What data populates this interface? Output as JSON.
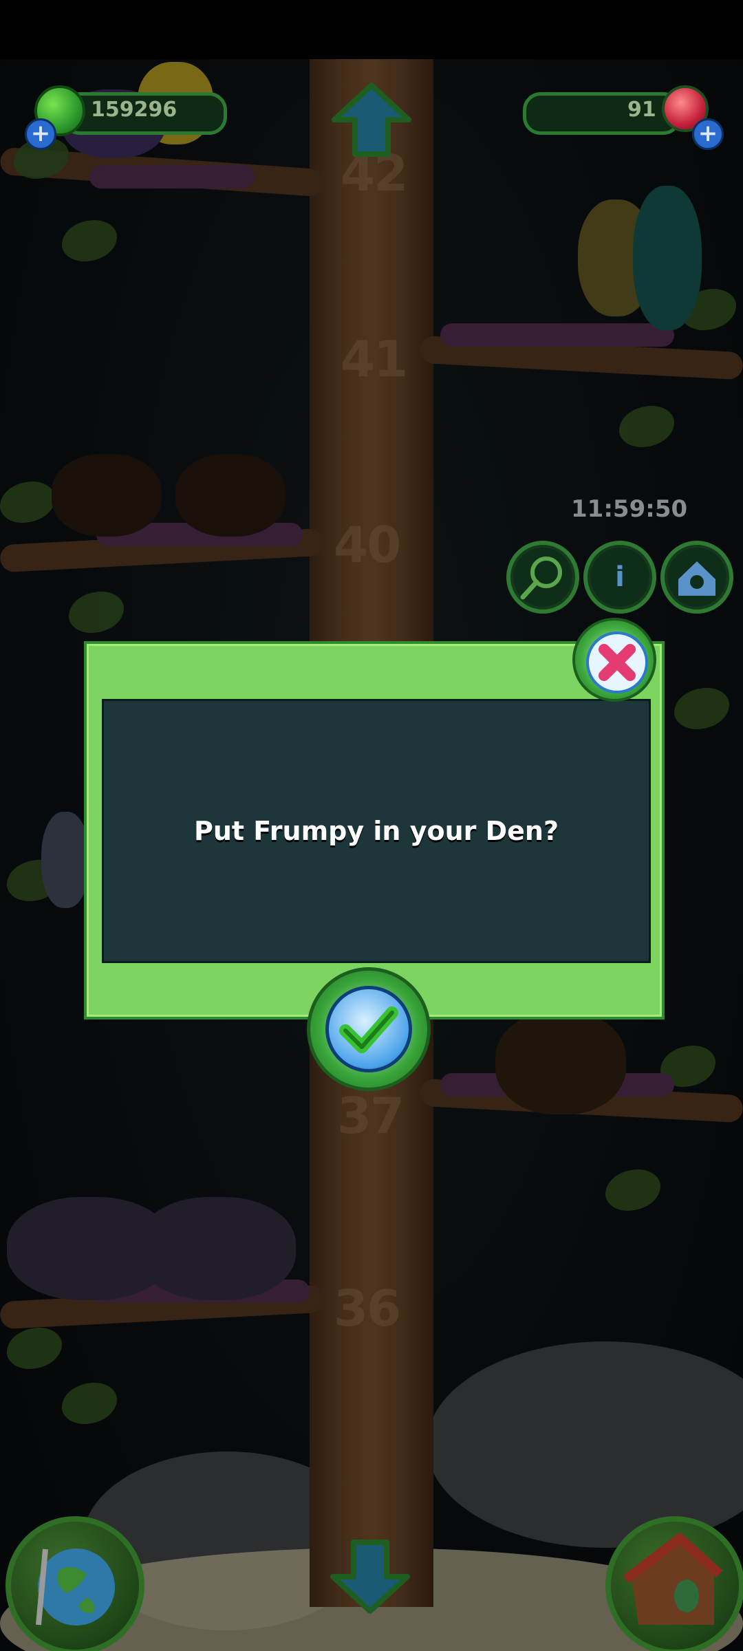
{
  "hud": {
    "coins": "159296",
    "gems": "91",
    "coin_plus": "+",
    "gem_plus": "+"
  },
  "timer": "11:59:50",
  "levels": [
    "42",
    "41",
    "40",
    "37",
    "36"
  ],
  "dialog": {
    "message": "Put Frumpy in your Den?"
  },
  "icons": {
    "up": "up-arrow-icon",
    "down": "down-arrow-icon",
    "net": "net-icon",
    "info": "info-icon",
    "den": "den-icon",
    "close": "close-icon",
    "confirm": "check-icon",
    "map": "globe-icon",
    "house": "house-icon"
  },
  "colors": {
    "dialog_green": "#7ed460",
    "dialog_panel": "#1d3639",
    "trunk": "#5d3e25"
  }
}
